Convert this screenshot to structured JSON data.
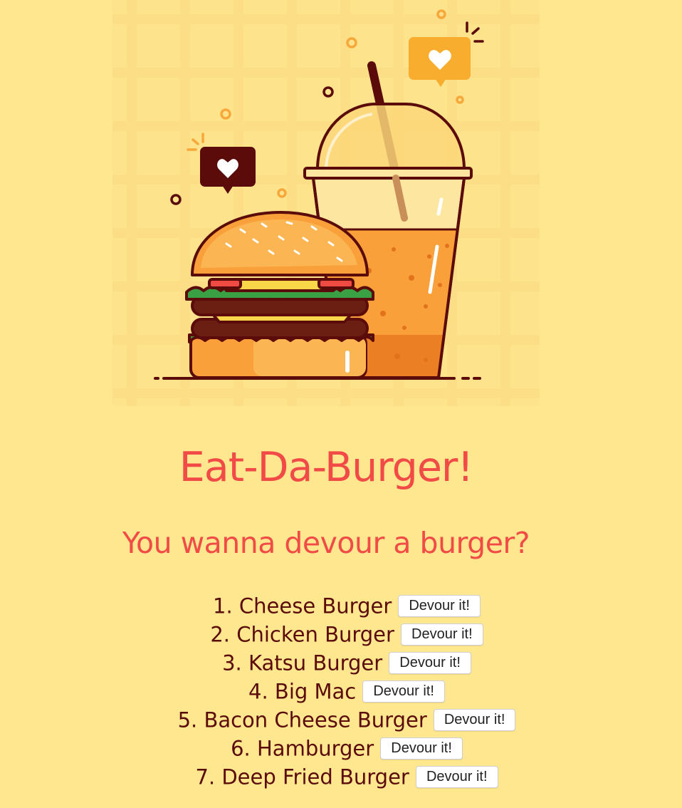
{
  "header": {
    "title": "Eat-Da-Burger!",
    "subtitle": "You wanna devour a burger?"
  },
  "hero_image": {
    "icon": "burger-and-drink-illustration"
  },
  "burgers": [
    {
      "label": "1. Cheese Burger",
      "button": "Devour it!"
    },
    {
      "label": "2. Chicken Burger",
      "button": "Devour it!"
    },
    {
      "label": "3. Katsu Burger",
      "button": "Devour it!"
    },
    {
      "label": "4. Big Mac",
      "button": "Devour it!"
    },
    {
      "label": "5. Bacon Cheese Burger",
      "button": "Devour it!"
    },
    {
      "label": "6. Hamburger",
      "button": "Devour it!"
    },
    {
      "label": "7. Deep Fried Burger",
      "button": "Devour it!"
    }
  ],
  "colors": {
    "background": "#fee78e",
    "accent": "#f24a46",
    "text": "#5a0b0a"
  }
}
